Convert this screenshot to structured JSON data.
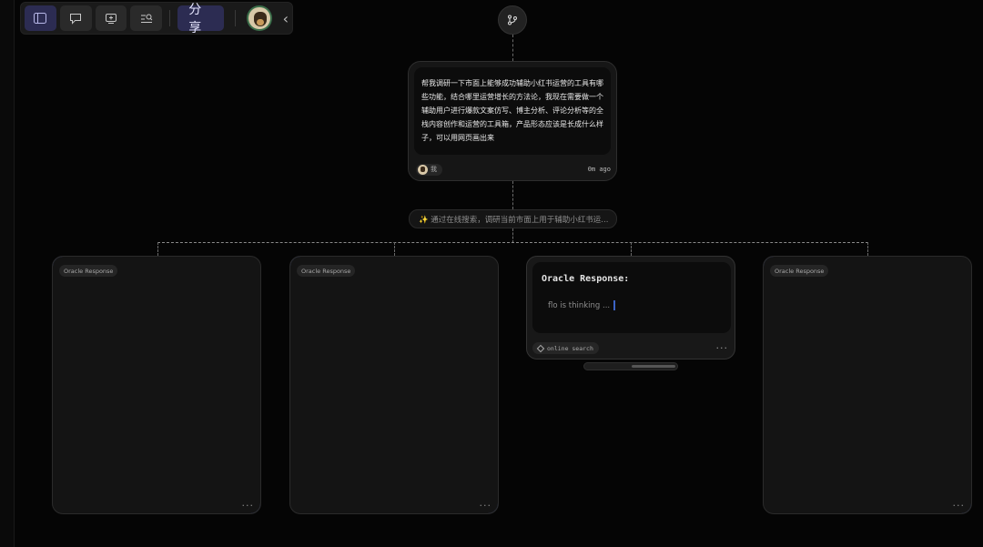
{
  "toolbar": {
    "share_label": "分享",
    "icons": [
      "sidebar-icon",
      "chat-icon",
      "add-frame-icon",
      "search-list-icon",
      "chevron-left-icon"
    ]
  },
  "message": {
    "text": "帮我调研一下市面上能够成功辅助小红书运营的工具有哪些功能，结合哪里运营增长的方法论，我现在需要做一个辅助用户进行爆款文案仿写、博主分析、评论分析等的全栈内容创作和运营的工具箱，产品形态应该是长成什么样子，可以用网页画出来",
    "user": "我",
    "time": "0m ago"
  },
  "search_pill": "✨ 通过在线搜索，调研当前市面上用于辅助小红书运...",
  "responses": [
    {
      "tag": "Oracle Response"
    },
    {
      "tag": "Oracle Response"
    },
    {
      "title": "Oracle Response:",
      "status": "flo is thinking ...",
      "chip": "online search"
    },
    {
      "tag": "Oracle Response"
    }
  ],
  "colors": {
    "background": "#050505",
    "accent": "#2c2c52",
    "border_glow": "#4a5aa0",
    "cursor": "#3b63c5"
  }
}
